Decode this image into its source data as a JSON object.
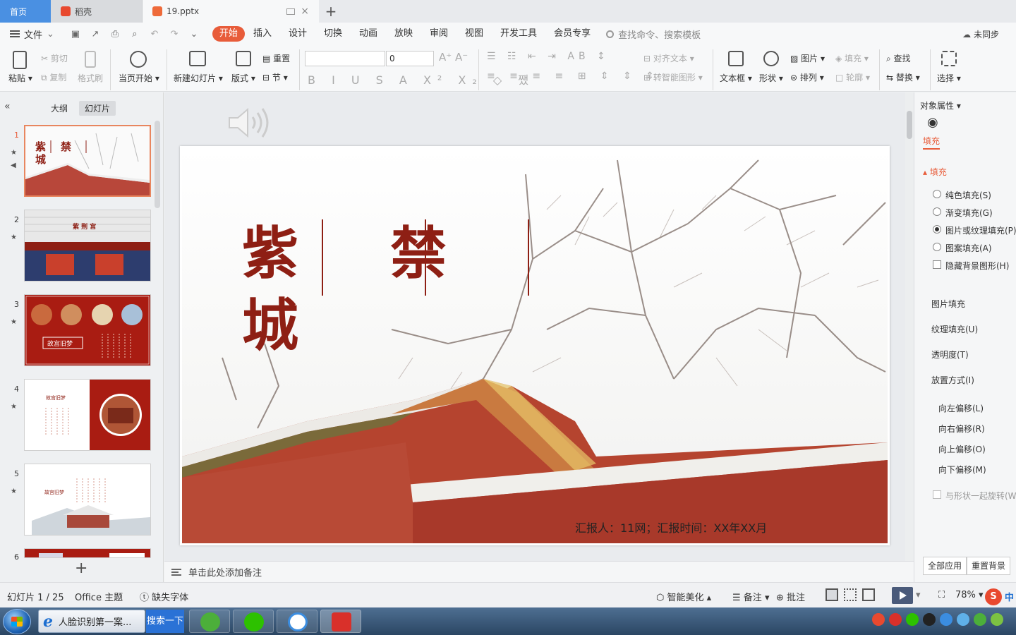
{
  "tabs": {
    "home": "首页",
    "docer": "稻壳",
    "file": "19.pptx"
  },
  "menu": {
    "file": "文件",
    "tabs": [
      "开始",
      "插入",
      "设计",
      "切换",
      "动画",
      "放映",
      "审阅",
      "视图",
      "开发工具",
      "会员专享"
    ],
    "search_placeholder": "查找命令、搜索模板",
    "sync": "未同步"
  },
  "ribbon": {
    "paste": "粘贴",
    "cut": "剪切",
    "copy": "复制",
    "format_painter": "格式刷",
    "from_current": "当页开始",
    "new_slide": "新建幻灯片",
    "layout": "版式",
    "reset": "重置",
    "section": "节",
    "font_size": "0",
    "align_text": "对齐文本",
    "to_smartart": "转智能图形",
    "textbox": "文本框",
    "shape": "形状",
    "picture": "图片",
    "arrange": "排列",
    "fill": "填充",
    "outline": "轮廓",
    "find": "查找",
    "replace": "替换",
    "select": "选择"
  },
  "left_panel": {
    "tab_outline": "大纲",
    "tab_slides": "幻灯片",
    "slide_numbers": [
      "1",
      "2",
      "3",
      "4",
      "5",
      "6"
    ],
    "thumb1_title": "紫 禁 城",
    "thumb2_title": "紫 荆 宫",
    "thumb3_label": "故宫旧梦",
    "thumb4_label": "故宫旧梦",
    "thumb5_label": "故宫旧梦"
  },
  "slide": {
    "char1": "紫",
    "char2": "禁",
    "char3": "城",
    "reporter": "汇报人：11网；汇报时间：XX年XX月"
  },
  "notes": {
    "placeholder": "单击此处添加备注"
  },
  "right_panel": {
    "title": "对象属性",
    "fill_tab": "填充",
    "fill_section": "填充",
    "opt_solid": "纯色填充(S)",
    "opt_gradient": "渐变填充(G)",
    "opt_picture": "图片或纹理填充(P)",
    "opt_pattern": "图案填充(A)",
    "opt_hide_bg": "隐藏背景图形(H)",
    "picture_fill": "图片填充",
    "texture_fill": "纹理填充(U)",
    "transparency": "透明度(T)",
    "placement": "放置方式(I)",
    "offset_left": "向左偏移(L)",
    "offset_right": "向右偏移(R)",
    "offset_up": "向上偏移(O)",
    "offset_down": "向下偏移(M)",
    "rotate_with_shape": "与形状一起旋转(W)",
    "apply_all": "全部应用",
    "reset_bg": "重置背景"
  },
  "status": {
    "slide_info": "幻灯片 1 / 25",
    "theme": "Office 主题",
    "missing_font": "缺失字体",
    "beautify": "智能美化",
    "notes": "备注",
    "comments": "批注",
    "zoom": "78%",
    "ime": "中"
  },
  "taskbar": {
    "ie_title": "人脸识别第一案...",
    "search_btn": "搜索一下"
  },
  "colors": {
    "accent": "#e85c3a",
    "title_red": "#8e1f14",
    "home_tab": "#4a90e2"
  }
}
